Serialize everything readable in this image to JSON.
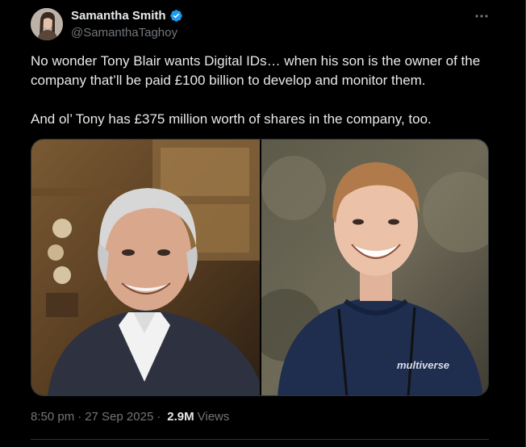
{
  "author": {
    "display_name": "Samantha Smith",
    "handle": "@SamanthaTaghoy",
    "verified_icon": "verified-badge-icon"
  },
  "tweet": {
    "paragraphs": [
      "No wonder Tony Blair wants Digital IDs… when his son is the owner of the company that’ll be paid £100 billion to develop and monitor them.",
      "And ol’ Tony has £375 million worth of shares in the company, too."
    ],
    "time": "8:50 pm",
    "separator": "·",
    "date": "27 Sep 2025",
    "views_count": "2.9M",
    "views_label": "Views"
  },
  "media": {
    "right_photo_logo_text": "multiverse"
  },
  "colors": {
    "background": "#000000",
    "text_primary": "#e7e9ea",
    "text_secondary": "#71767b",
    "verified_blue": "#1d9bf0",
    "border": "#2f3336"
  },
  "icons": {
    "more": "more-dots-icon"
  }
}
